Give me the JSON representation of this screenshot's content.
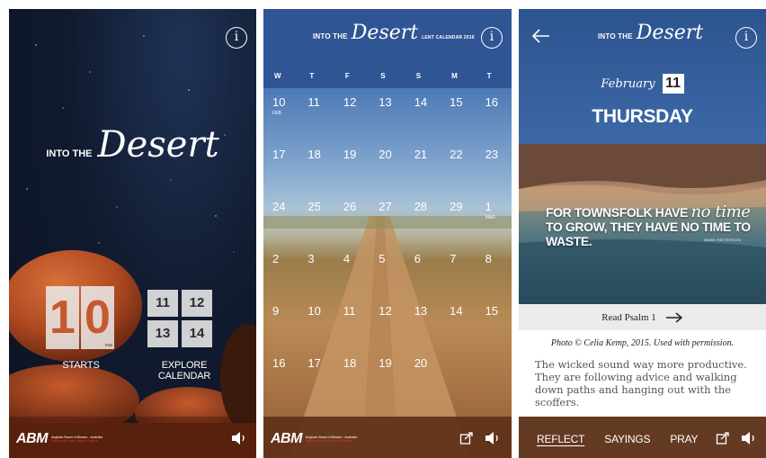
{
  "screen1": {
    "brand_into": "INTO THE",
    "brand_desert": "Desert",
    "starts_day_tens": "1",
    "starts_day_units": "0",
    "starts_month_small": "FEB",
    "starts_label": "STARTS",
    "mini_calendar": [
      "11",
      "12",
      "13",
      "14"
    ],
    "explore_label": "EXPLORE CALENDAR",
    "info_icon": "i"
  },
  "screen2": {
    "brand_into": "INTO THE",
    "brand_desert": "Desert",
    "brand_suffix": "LENT CALENDAR 2016",
    "info_icon": "i",
    "weekdays": [
      "W",
      "T",
      "F",
      "S",
      "S",
      "M",
      "T"
    ],
    "days": [
      {
        "d": "10",
        "m": "FEB"
      },
      {
        "d": "11",
        "m": ""
      },
      {
        "d": "12",
        "m": ""
      },
      {
        "d": "13",
        "m": ""
      },
      {
        "d": "14",
        "m": ""
      },
      {
        "d": "15",
        "m": ""
      },
      {
        "d": "16",
        "m": ""
      },
      {
        "d": "17",
        "m": ""
      },
      {
        "d": "18",
        "m": ""
      },
      {
        "d": "19",
        "m": ""
      },
      {
        "d": "20",
        "m": ""
      },
      {
        "d": "21",
        "m": ""
      },
      {
        "d": "22",
        "m": ""
      },
      {
        "d": "23",
        "m": ""
      },
      {
        "d": "24",
        "m": ""
      },
      {
        "d": "25",
        "m": ""
      },
      {
        "d": "26",
        "m": ""
      },
      {
        "d": "27",
        "m": ""
      },
      {
        "d": "28",
        "m": ""
      },
      {
        "d": "29",
        "m": ""
      },
      {
        "d": "1",
        "m": "MAR"
      },
      {
        "d": "2",
        "m": ""
      },
      {
        "d": "3",
        "m": ""
      },
      {
        "d": "4",
        "m": ""
      },
      {
        "d": "5",
        "m": ""
      },
      {
        "d": "6",
        "m": ""
      },
      {
        "d": "7",
        "m": ""
      },
      {
        "d": "8",
        "m": ""
      },
      {
        "d": "9",
        "m": ""
      },
      {
        "d": "10",
        "m": ""
      },
      {
        "d": "11",
        "m": ""
      },
      {
        "d": "12",
        "m": ""
      },
      {
        "d": "13",
        "m": ""
      },
      {
        "d": "14",
        "m": ""
      },
      {
        "d": "15",
        "m": ""
      },
      {
        "d": "16",
        "m": ""
      },
      {
        "d": "17",
        "m": ""
      },
      {
        "d": "18",
        "m": ""
      },
      {
        "d": "19",
        "m": ""
      },
      {
        "d": "20",
        "m": ""
      }
    ]
  },
  "screen3": {
    "brand_into": "INTO THE",
    "brand_desert": "Desert",
    "info_icon": "i",
    "month": "February",
    "day": "11",
    "weekday": "THURSDAY",
    "quote_part1": "FOR TOWNSFOLK HAVE ",
    "quote_emph": "no time",
    "quote_part2": " TO GROW, THEY HAVE NO TIME TO WASTE.",
    "quote_source": "MARK PATTERSON",
    "read_label": "Read Psalm 1",
    "credit": "Photo © Celia Kemp, 2015. Used with permission.",
    "body": "The wicked sound way more productive. They are following advice and walking down paths and hanging out with the scoffers.",
    "tabs": [
      "REFLECT",
      "SAYINGS",
      "PRAY"
    ]
  },
  "footer": {
    "abm": "ABM",
    "abm_line1": "Anglican Board of Mission - Australia",
    "abm_line2": "Working for Love, Hope & Justice"
  },
  "colors": {
    "night_sky": "#111b30",
    "header_blue": "#2f5594",
    "footer_brown": "#5f3018",
    "tile_grey": "#ebebeb",
    "rock_orange": "#c45a2e"
  },
  "icons": [
    "info-icon",
    "back-arrow-icon",
    "right-arrow-icon",
    "share-icon",
    "sound-icon"
  ]
}
